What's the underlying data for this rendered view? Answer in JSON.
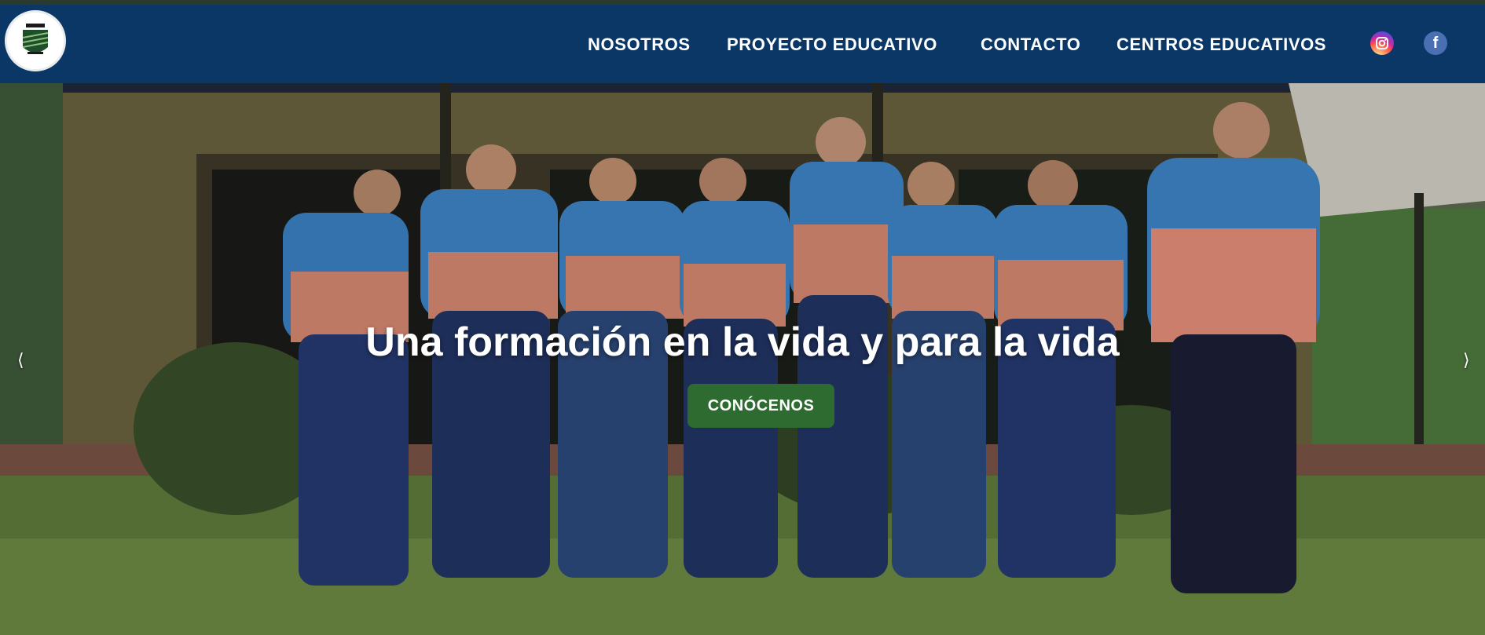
{
  "header": {
    "logo_icon": "school-crest-icon",
    "nav": [
      {
        "label": "NOSOTROS"
      },
      {
        "label": "PROYECTO EDUCATIVO"
      },
      {
        "label": "CONTACTO"
      },
      {
        "label": "CENTROS EDUCATIVOS"
      }
    ],
    "social": [
      {
        "icon": "instagram-icon"
      },
      {
        "icon": "facebook-icon",
        "glyph": "f"
      }
    ],
    "colors": {
      "bar": "#0b3766",
      "text": "#ffffff"
    }
  },
  "hero": {
    "title": "Una formación en la vida y para la vida",
    "cta_label": "CONÓCENOS",
    "prev_glyph": "⟨",
    "next_glyph": "⟩",
    "colors": {
      "cta": "#2e6b30"
    }
  }
}
